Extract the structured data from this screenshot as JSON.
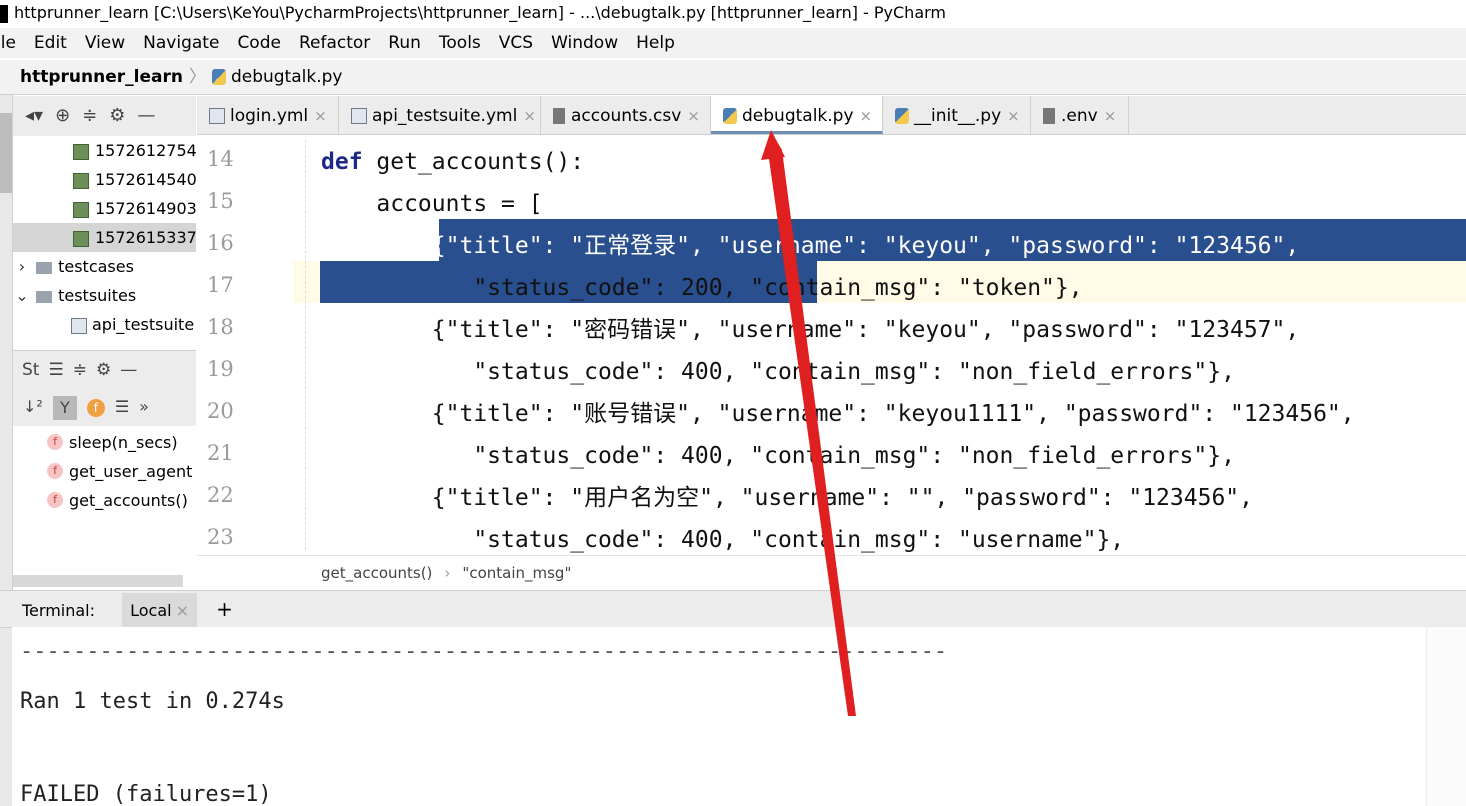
{
  "window": {
    "title": "httprunner_learn [C:\\Users\\KeYou\\PycharmProjects\\httprunner_learn] - ...\\debugtalk.py [httprunner_learn] - PyCharm"
  },
  "menu": [
    "ile",
    "Edit",
    "View",
    "Navigate",
    "Code",
    "Refactor",
    "Run",
    "Tools",
    "VCS",
    "Window",
    "Help"
  ],
  "nav": {
    "project": "httprunner_learn",
    "file": "debugtalk.py"
  },
  "project_tree": {
    "items": [
      {
        "label": "1572612754",
        "type": "report"
      },
      {
        "label": "1572614540",
        "type": "report"
      },
      {
        "label": "1572614903",
        "type": "report"
      },
      {
        "label": "1572615337",
        "type": "report"
      },
      {
        "label": "testcases",
        "type": "folder"
      },
      {
        "label": "testsuites",
        "type": "folder"
      },
      {
        "label": "api_testsuite",
        "type": "file"
      }
    ]
  },
  "structure": {
    "title": "St",
    "items": [
      "sleep(n_secs)",
      "get_user_agent",
      "get_accounts()"
    ]
  },
  "tabs": [
    {
      "label": "login.yml",
      "icon": "yml-icon"
    },
    {
      "label": "api_testsuite.yml",
      "icon": "yml-icon"
    },
    {
      "label": "accounts.csv",
      "icon": "csv-icon"
    },
    {
      "label": "debugtalk.py",
      "icon": "python-icon",
      "active": true
    },
    {
      "label": "__init__.py",
      "icon": "python-icon"
    },
    {
      "label": ".env",
      "icon": "env-icon"
    }
  ],
  "editor": {
    "line_numbers": [
      "14",
      "15",
      "16",
      "17",
      "18",
      "19",
      "20",
      "21",
      "22",
      "23"
    ],
    "lines": [
      "def get_accounts():",
      "    accounts = [",
      "        {\"title\": \"正常登录\", \"username\": \"keyou\", \"password\": \"123456\",",
      "           \"status_code\": 200, \"contain_msg\": \"token\"},",
      "        {\"title\": \"密码错误\", \"username\": \"keyou\", \"password\": \"123457\",",
      "           \"status_code\": 400, \"contain_msg\": \"non_field_errors\"},",
      "        {\"title\": \"账号错误\", \"username\": \"keyou1111\", \"password\": \"123456\",",
      "           \"status_code\": 400, \"contain_msg\": \"non_field_errors\"},",
      "        {\"title\": \"用户名为空\", \"username\": \"\", \"password\": \"123456\",",
      "           \"status_code\": 400, \"contain_msg\": \"username\"},"
    ],
    "breadcrumb": [
      "get_accounts()",
      "\"contain_msg\""
    ],
    "selected_lines": [
      16,
      17
    ]
  },
  "terminal": {
    "label": "Terminal:",
    "tab": "Local",
    "lines": [
      "----------------------------------------------------------------------",
      "",
      "Ran 1 test in 0.274s",
      "",
      "",
      "FAILED (failures=1)"
    ]
  },
  "colors": {
    "selection": "#2a4f8f",
    "keyword": "#1f2a88",
    "number": "#1f3fd6",
    "annotation_arrow": "#e02020"
  }
}
